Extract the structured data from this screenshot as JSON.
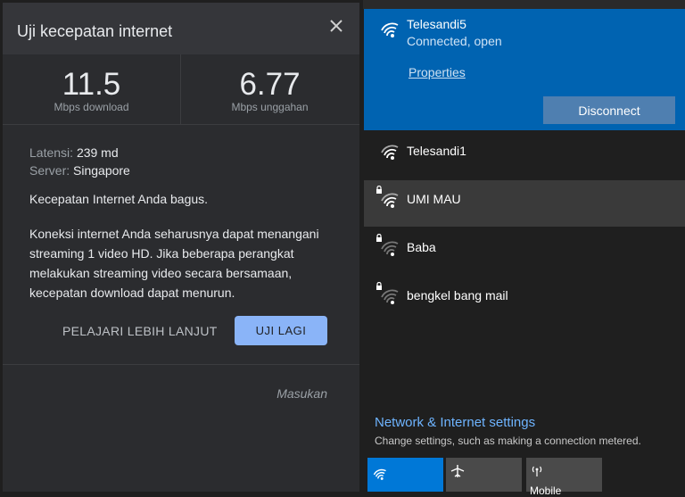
{
  "speedtest": {
    "title": "Uji kecepatan internet",
    "download": {
      "value": "11.5",
      "unit": "Mbps download"
    },
    "upload": {
      "value": "6.77",
      "unit": "Mbps unggahan"
    },
    "latency_label": "Latensi:",
    "latency_value": "239 md",
    "server_label": "Server:",
    "server_value": "Singapore",
    "verdict": "Kecepatan Internet Anda bagus.",
    "description_lines": [
      "Koneksi internet Anda seharusnya dapat menangani",
      "streaming 1 video HD. Jika beberapa perangkat",
      "melakukan streaming video secara bersamaan,",
      "kecepatan download dapat menurun."
    ],
    "learn_more": "PELAJARI LEBIH LANJUT",
    "retry": "UJI LAGI",
    "feedback": "Masukan"
  },
  "network": {
    "connected": {
      "ssid": "Telesandi5",
      "status": "Connected, open",
      "properties": "Properties",
      "disconnect": "Disconnect"
    },
    "networks": [
      {
        "ssid": "Telesandi1",
        "secured": false
      },
      {
        "ssid": "UMI MAU",
        "secured": true,
        "hover": true
      },
      {
        "ssid": "Baba",
        "secured": true
      },
      {
        "ssid": "bengkel bang mail",
        "secured": true
      }
    ],
    "settings_link": "Network & Internet settings",
    "settings_desc": "Change settings, such as making a connection metered.",
    "tiles": [
      {
        "icon": "wifi-icon",
        "label": ""
      },
      {
        "icon": "airplane-icon",
        "label": ""
      },
      {
        "icon": "mobile-hotspot-icon",
        "label": "Mobile"
      }
    ]
  }
}
